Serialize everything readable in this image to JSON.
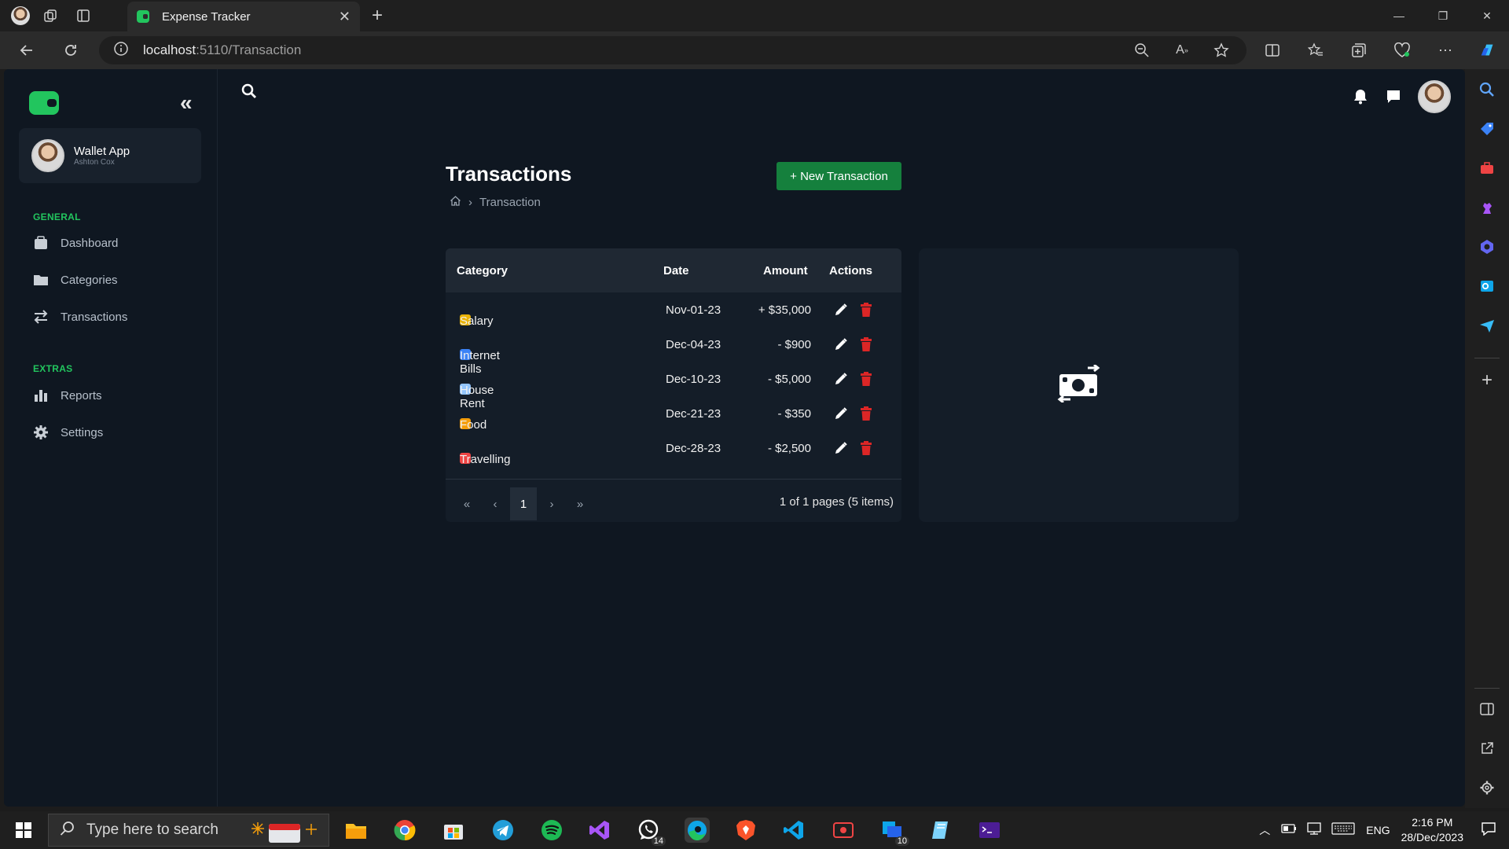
{
  "browser": {
    "tab_title": "Expense Tracker",
    "url_host": "localhost",
    "url_path": ":5110/Transaction"
  },
  "sidebar": {
    "profile": {
      "name": "Wallet App",
      "subtitle": "Ashton Cox"
    },
    "sections": [
      {
        "title": "GENERAL",
        "items": [
          {
            "label": "Dashboard",
            "icon": "dashboard-icon"
          },
          {
            "label": "Categories",
            "icon": "folder-icon"
          },
          {
            "label": "Transactions",
            "icon": "exchange-icon"
          }
        ]
      },
      {
        "title": "EXTRAS",
        "items": [
          {
            "label": "Reports",
            "icon": "bar-chart-icon"
          },
          {
            "label": "Settings",
            "icon": "gear-icon"
          }
        ]
      }
    ]
  },
  "page": {
    "title": "Transactions",
    "new_button": "+ New Transaction",
    "breadcrumb": "Transaction"
  },
  "table": {
    "headers": {
      "category": "Category",
      "date": "Date",
      "amount": "Amount",
      "actions": "Actions"
    },
    "rows": [
      {
        "category": "Salary",
        "date": "Nov-01-23",
        "amount": "+ $35,000",
        "icon_color": "#eab308"
      },
      {
        "category": "Internet Bills",
        "date": "Dec-04-23",
        "amount": "- $900",
        "icon_color": "#3b82f6"
      },
      {
        "category": "House Rent",
        "date": "Dec-10-23",
        "amount": "- $5,000",
        "icon_color": "#93c5fd"
      },
      {
        "category": "Food",
        "date": "Dec-21-23",
        "amount": "- $350",
        "icon_color": "#f59e0b"
      },
      {
        "category": "Travelling",
        "date": "Dec-28-23",
        "amount": "- $2,500",
        "icon_color": "#ef4444"
      }
    ],
    "pager": {
      "current": "1",
      "info": "1 of 1 pages (5 items)"
    }
  },
  "taskbar": {
    "search_placeholder": "Type here to search",
    "whatsapp_badge": "14",
    "outlook_badge": "10",
    "lang": "ENG",
    "time": "2:16 PM",
    "date": "28/Dec/2023"
  },
  "colors": {
    "accent": "#22c55e",
    "button": "#15803d",
    "delete": "#dc2626",
    "app_bg": "#0f1721",
    "card_bg": "#141d28"
  }
}
